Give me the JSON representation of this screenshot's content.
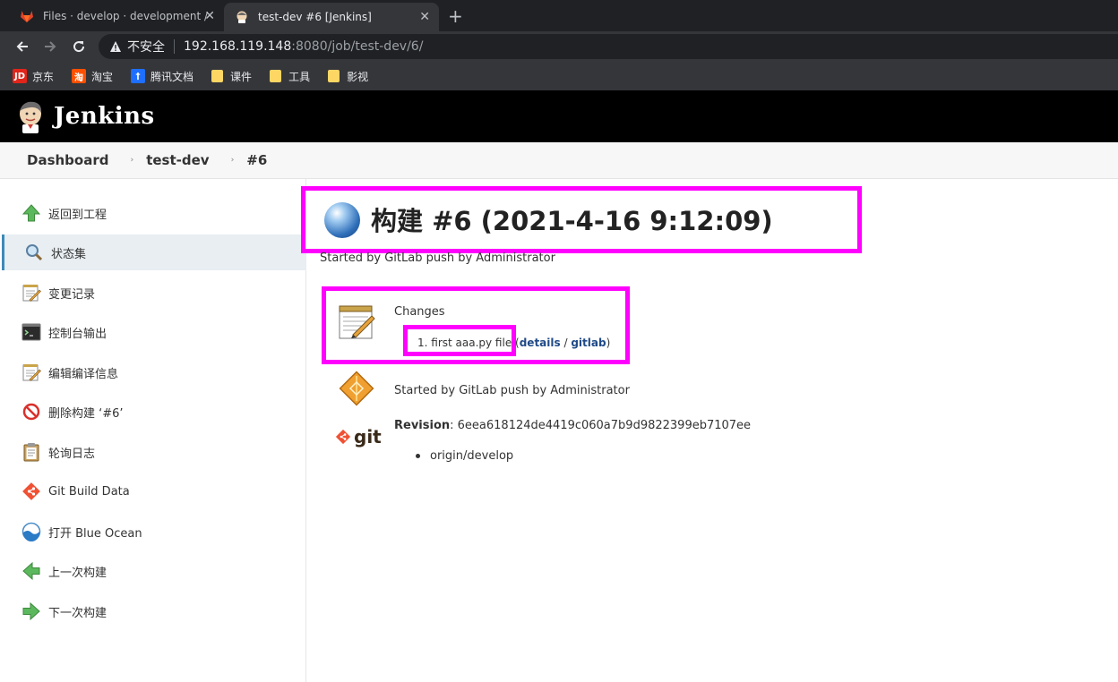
{
  "browser": {
    "tabs": [
      {
        "title": "Files · develop · development /",
        "active": false,
        "icon": "gitlab-fox-icon"
      },
      {
        "title": "test-dev #6 [Jenkins]",
        "active": true,
        "icon": "jenkins-icon"
      }
    ],
    "new_tab": "+",
    "close_glyph": "✕",
    "security_label": "不安全",
    "url_host": "192.168.119.148",
    "url_path": ":8080/job/test-dev/6/",
    "bookmarks": [
      {
        "label": "京东",
        "icon": "jd-icon",
        "badge": "JD",
        "color": "#e1251b"
      },
      {
        "label": "淘宝",
        "icon": "taobao-icon",
        "badge": "淘",
        "color": "#ff5000"
      },
      {
        "label": "腾讯文档",
        "icon": "tencent-docs-icon",
        "badge": "†",
        "color": "#1e6fff"
      },
      {
        "label": "课件",
        "icon": "folder-icon"
      },
      {
        "label": "工具",
        "icon": "folder-icon"
      },
      {
        "label": "影视",
        "icon": "folder-icon"
      }
    ]
  },
  "jenkins": {
    "brand": "Jenkins",
    "breadcrumbs": [
      "Dashboard",
      "test-dev",
      "#6"
    ],
    "breadcrumb_sep": "›",
    "side_tasks": [
      {
        "label": "返回到工程",
        "icon": "up-arrow-icon"
      },
      {
        "label": "状态集",
        "icon": "search-icon",
        "selected": true
      },
      {
        "label": "变更记录",
        "icon": "notepad-icon"
      },
      {
        "label": "控制台输出",
        "icon": "terminal-icon"
      },
      {
        "label": "编辑编译信息",
        "icon": "notepad-icon"
      },
      {
        "label": "删除构建 ‘#6’",
        "icon": "no-entry-icon"
      },
      {
        "label": "轮询日志",
        "icon": "clipboard-icon"
      },
      {
        "label": "Git Build Data",
        "icon": "git-icon"
      },
      {
        "label": "打开 Blue Ocean",
        "icon": "blue-ocean-icon"
      },
      {
        "label": "上一次构建",
        "icon": "left-arrow-icon"
      },
      {
        "label": "下一次构建",
        "icon": "right-arrow-icon"
      }
    ],
    "build": {
      "title": "构建 #6 (2021-4-16 9:12:09)",
      "status_color": "#2f6fb9",
      "started_by": "Started by GitLab push by Administrator",
      "changes_label": "Changes",
      "change_item": "1. first aaa.py file",
      "change_open": " (",
      "details_link": "details",
      "link_sep": " / ",
      "gitlab_link": "gitlab",
      "change_close": ")",
      "started_by_2": "Started by GitLab push by Administrator",
      "git_label": "git",
      "revision_label": "Revision",
      "revision_value": ": 6eea618124de4419c060a7b9d9822399eb7107ee",
      "branch": "origin/develop"
    },
    "highlight_color": "#ff00ff"
  }
}
